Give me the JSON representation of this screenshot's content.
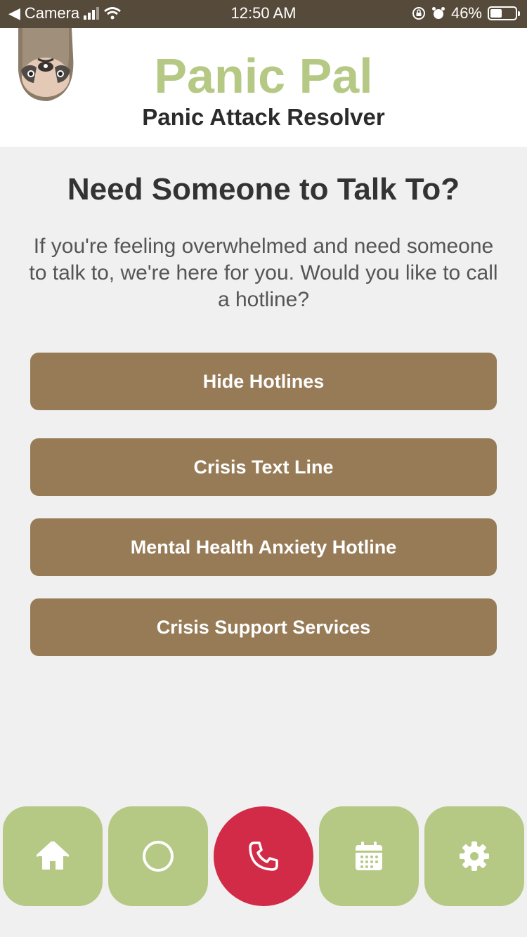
{
  "status_bar": {
    "back_app": "Camera",
    "time": "12:50 AM",
    "battery": "46%",
    "battery_level": 0.46
  },
  "header": {
    "title": "Panic Pal",
    "subtitle": "Panic Attack Resolver",
    "mascot_icon": "sloth-mascot-icon"
  },
  "main": {
    "title": "Need Someone to Talk To?",
    "description": "If you're feeling overwhelmed and need someone to talk to, we're here for you. Would you like to call a hotline?",
    "toggle_label": "Hide Hotlines",
    "hotlines": [
      "Crisis Text Line",
      "Mental Health Anxiety Hotline",
      "Crisis Support Services"
    ]
  },
  "tabs": [
    {
      "icon": "home-icon"
    },
    {
      "icon": "circle-icon"
    },
    {
      "icon": "phone-icon",
      "active": true
    },
    {
      "icon": "calendar-icon"
    },
    {
      "icon": "gear-icon"
    }
  ],
  "colors": {
    "brand_green": "#b5c984",
    "button_brown": "#977b57",
    "active_red": "#d22b48",
    "status_bar": "#564a3a"
  }
}
